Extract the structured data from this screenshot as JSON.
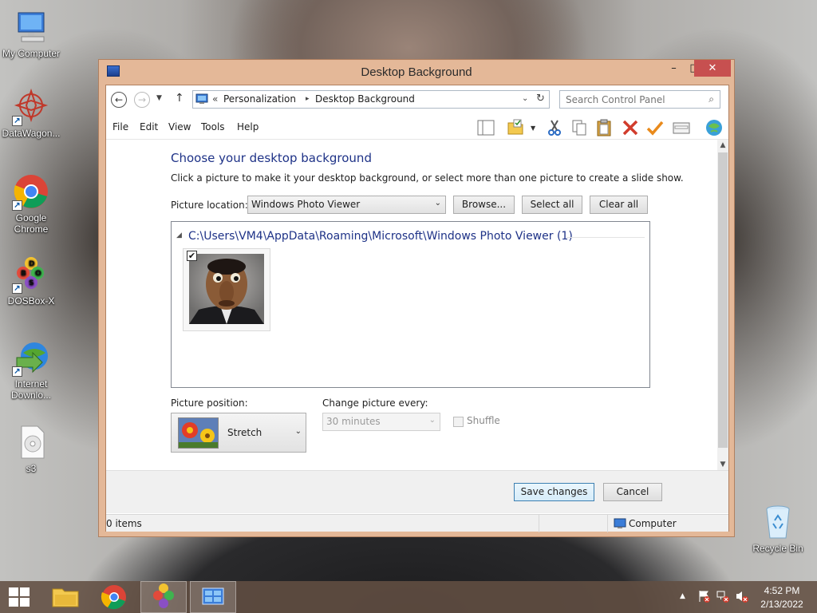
{
  "desktop": {
    "icons": [
      {
        "label": "My Computer"
      },
      {
        "label": "DataWagon..."
      },
      {
        "label": "Google Chrome"
      },
      {
        "label": "DOSBox-X"
      },
      {
        "label": "Internet Downlo..."
      },
      {
        "label": "s3"
      },
      {
        "label": "Recycle Bin"
      }
    ]
  },
  "window": {
    "title": "Desktop Background",
    "controls": {
      "minimize": "–",
      "maximize": "□",
      "close": "✕"
    },
    "address": {
      "overflow": "«",
      "crumbs": [
        "Personalization",
        "Desktop Background"
      ],
      "separator": "▸"
    },
    "search": {
      "placeholder": "Search Control Panel"
    },
    "menu": [
      "File",
      "Edit",
      "View",
      "Tools",
      "Help"
    ],
    "content": {
      "heading": "Choose your desktop background",
      "subtext": "Click a picture to make it your desktop background, or select more than one picture to create a slide show.",
      "picture_location_label": "Picture location:",
      "picture_location_value": "Windows Photo Viewer",
      "browse": "Browse...",
      "select_all": "Select all",
      "clear_all": "Clear all",
      "group_title": "C:\\Users\\VM4\\AppData\\Roaming\\Microsoft\\Windows Photo Viewer (1)",
      "thumbnail_checked": "✔",
      "picture_position_label": "Picture position:",
      "picture_position_value": "Stretch",
      "change_every_label": "Change picture every:",
      "change_every_value": "30 minutes",
      "shuffle_label": "Shuffle"
    },
    "footer": {
      "save": "Save changes",
      "cancel": "Cancel"
    },
    "status": {
      "items": "0 items",
      "location": "Computer"
    }
  },
  "taskbar": {
    "time": "4:52 PM",
    "date": "2/13/2022"
  },
  "colors": {
    "window_frame": "#e4b898",
    "close_button": "#c75050",
    "heading_blue": "#1e3287",
    "taskbar": "#624e42"
  }
}
